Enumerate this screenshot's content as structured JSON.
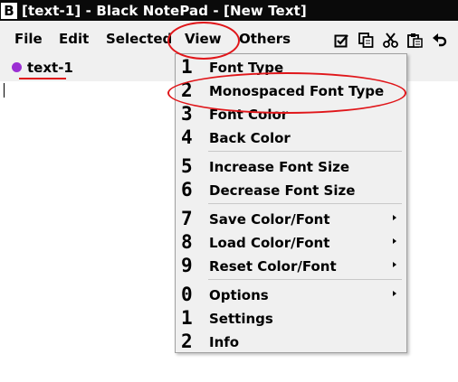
{
  "window": {
    "title": "[text-1] - Black NotePad - [New Text]",
    "app_icon_letter": "B"
  },
  "menubar": {
    "items": [
      "File",
      "Edit",
      "Selected",
      "View",
      "Others"
    ]
  },
  "toolbar": {
    "icons": [
      "select-all-icon",
      "copy-icon",
      "cut-icon",
      "paste-icon",
      "undo-icon"
    ]
  },
  "tabs": [
    {
      "label": "text-1",
      "dot_color": "#9b2fd3"
    }
  ],
  "view_menu": {
    "items": [
      {
        "key": "1",
        "label": "Font Type"
      },
      {
        "key": "2",
        "label": "Monospaced Font Type"
      },
      {
        "key": "3",
        "label": "Font Color"
      },
      {
        "key": "4",
        "label": "Back Color"
      },
      {
        "key": "5",
        "label": "Increase Font Size"
      },
      {
        "key": "6",
        "label": "Decrease Font Size"
      },
      {
        "key": "7",
        "label": "Save Color/Font",
        "submenu": true
      },
      {
        "key": "8",
        "label": "Load Color/Font",
        "submenu": true
      },
      {
        "key": "9",
        "label": "Reset Color/Font",
        "submenu": true
      },
      {
        "key": "0",
        "label": "Options",
        "submenu": true
      },
      {
        "key": "1",
        "label": "Settings"
      },
      {
        "key": "2",
        "label": "Info"
      }
    ]
  },
  "colors": {
    "highlight": "#e0161a",
    "titlebar": "#0a0a0a",
    "menu_bg": "#f0f0f0"
  }
}
